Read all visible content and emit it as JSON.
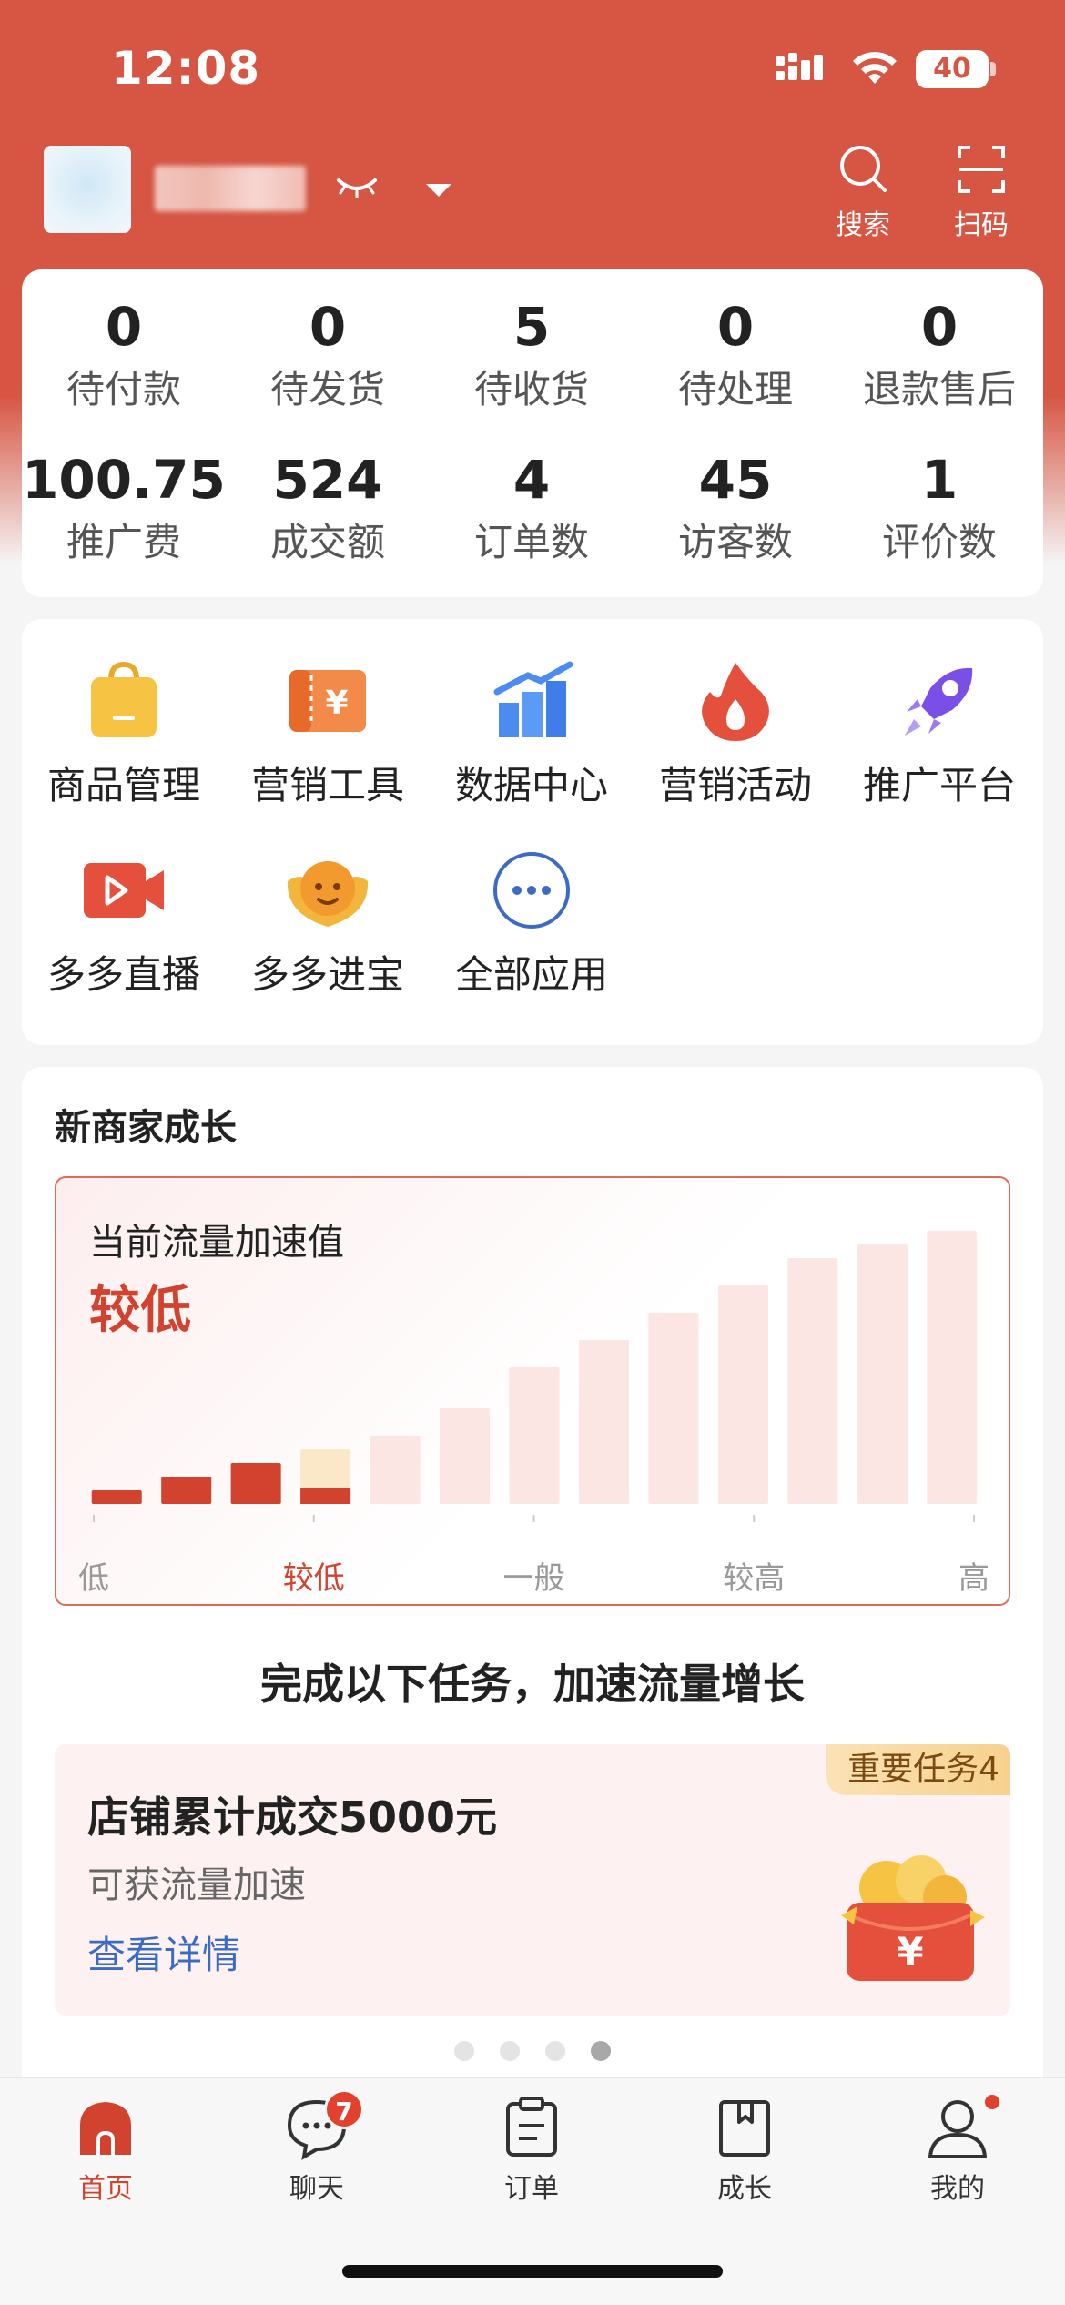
{
  "status_bar": {
    "time": "12:08",
    "battery": "40"
  },
  "header": {
    "search_label": "搜索",
    "scan_label": "扫码"
  },
  "stats": {
    "row1": [
      {
        "value": "0",
        "label": "待付款"
      },
      {
        "value": "0",
        "label": "待发货"
      },
      {
        "value": "5",
        "label": "待收货"
      },
      {
        "value": "0",
        "label": "待处理"
      },
      {
        "value": "0",
        "label": "退款售后"
      }
    ],
    "row2": [
      {
        "value": "100.75",
        "label": "推广费"
      },
      {
        "value": "524",
        "label": "成交额"
      },
      {
        "value": "4",
        "label": "订单数"
      },
      {
        "value": "45",
        "label": "访客数"
      },
      {
        "value": "1",
        "label": "评价数"
      }
    ]
  },
  "apps": [
    {
      "name": "商品管理",
      "icon": "shopping-bag-icon"
    },
    {
      "name": "营销工具",
      "icon": "coupon-ticket-icon"
    },
    {
      "name": "数据中心",
      "icon": "bar-chart-icon"
    },
    {
      "name": "营销活动",
      "icon": "flame-icon"
    },
    {
      "name": "推广平台",
      "icon": "rocket-icon"
    },
    {
      "name": "多多直播",
      "icon": "video-camera-icon"
    },
    {
      "name": "多多进宝",
      "icon": "gold-ingot-icon"
    },
    {
      "name": "全部应用",
      "icon": "more-dots-icon"
    }
  ],
  "growth": {
    "title": "新商家成长",
    "speed_label": "当前流量加速值",
    "speed_value": "较低",
    "chart_data": {
      "type": "bar",
      "levels": [
        "低",
        "较低",
        "一般",
        "较高",
        "高"
      ],
      "active_level": "较低",
      "bar_count": 13,
      "values": [
        1,
        2,
        3,
        4,
        5,
        7,
        10,
        12,
        14,
        16,
        18,
        19,
        20
      ],
      "filled_count": 3,
      "partial_index": 3,
      "partial_fill": 0.3,
      "ylim": [
        0,
        20
      ],
      "colors": {
        "filled": "#d2432f",
        "empty": "#fbe6e4",
        "partial_top": "#fbe8c8"
      }
    },
    "tasks_heading": "完成以下任务，加速流量增长",
    "task": {
      "badge": "重要任务4",
      "title": "店铺累计成交5000元",
      "subtitle": "可获流量加速",
      "link": "查看详情"
    },
    "pager": {
      "count": 4,
      "active": 3
    }
  },
  "tabbar": {
    "items": [
      {
        "label": "首页",
        "icon": "home-icon",
        "active": true
      },
      {
        "label": "聊天",
        "icon": "chat-bubble-icon",
        "badge": "7"
      },
      {
        "label": "订单",
        "icon": "clipboard-icon"
      },
      {
        "label": "成长",
        "icon": "book-icon"
      },
      {
        "label": "我的",
        "icon": "user-icon"
      }
    ]
  },
  "colors": {
    "brand": "#d65543",
    "accent_red": "#d2432f",
    "link_blue": "#3c6bc4"
  }
}
